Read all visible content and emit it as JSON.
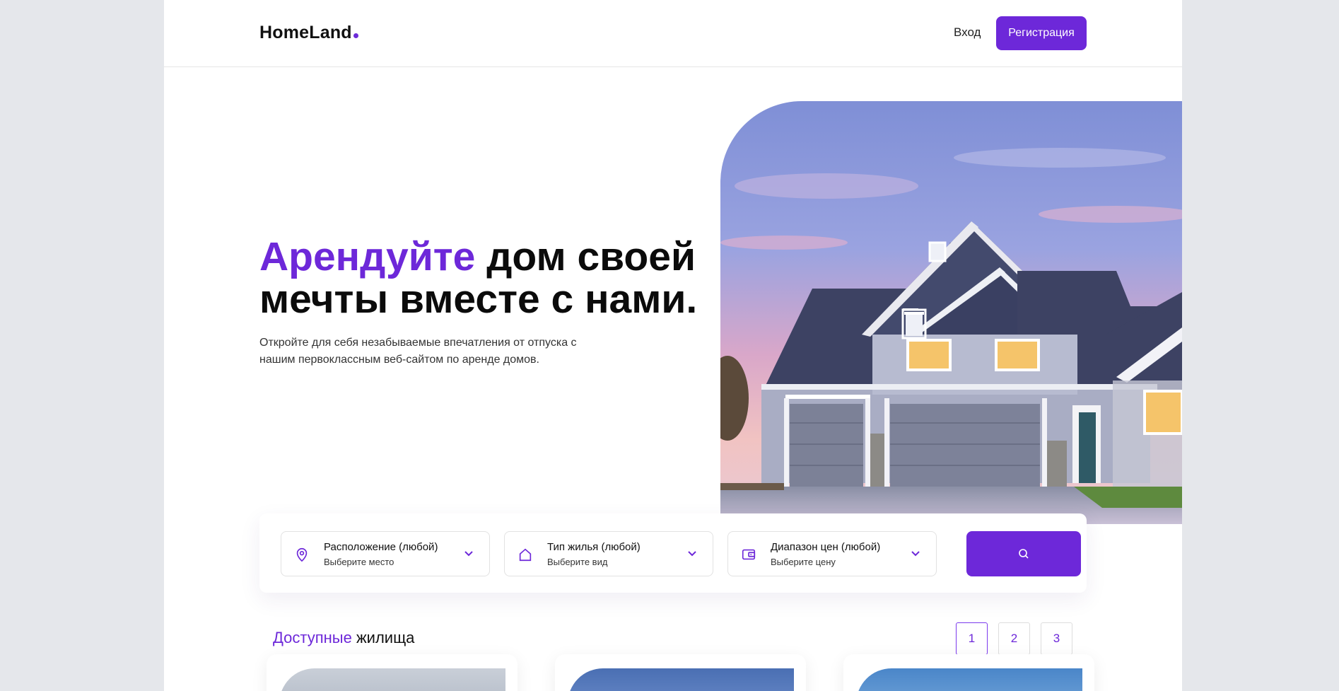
{
  "brand": {
    "name": "HomeLand",
    "accent_color": "#6d28d9"
  },
  "header": {
    "login_label": "Вход",
    "register_label": "Регистрация"
  },
  "hero": {
    "title_accent": "Арендуйте",
    "title_rest_line1": " дом своей",
    "title_line2": "мечты вместе с нами.",
    "subtitle": "Откройте для себя незабываемые впечатления от отпуска с нашим первоклассным веб-сайтом по аренде домов.",
    "image_icon": "house-photo"
  },
  "search": {
    "filters": [
      {
        "title": "Расположение (любой)",
        "subtitle": "Выберите место",
        "icon": "map-pin-icon"
      },
      {
        "title": "Тип жилья (любой)",
        "subtitle": "Выберите вид",
        "icon": "home-icon"
      },
      {
        "title": "Диапазон цен (любой)",
        "subtitle": "Выберите цену",
        "icon": "wallet-icon"
      }
    ],
    "button_icon": "search-icon"
  },
  "listings": {
    "title_accent": "Доступные",
    "title_rest": " жилища",
    "pages": [
      "1",
      "2",
      "3"
    ],
    "active_page": "1"
  }
}
